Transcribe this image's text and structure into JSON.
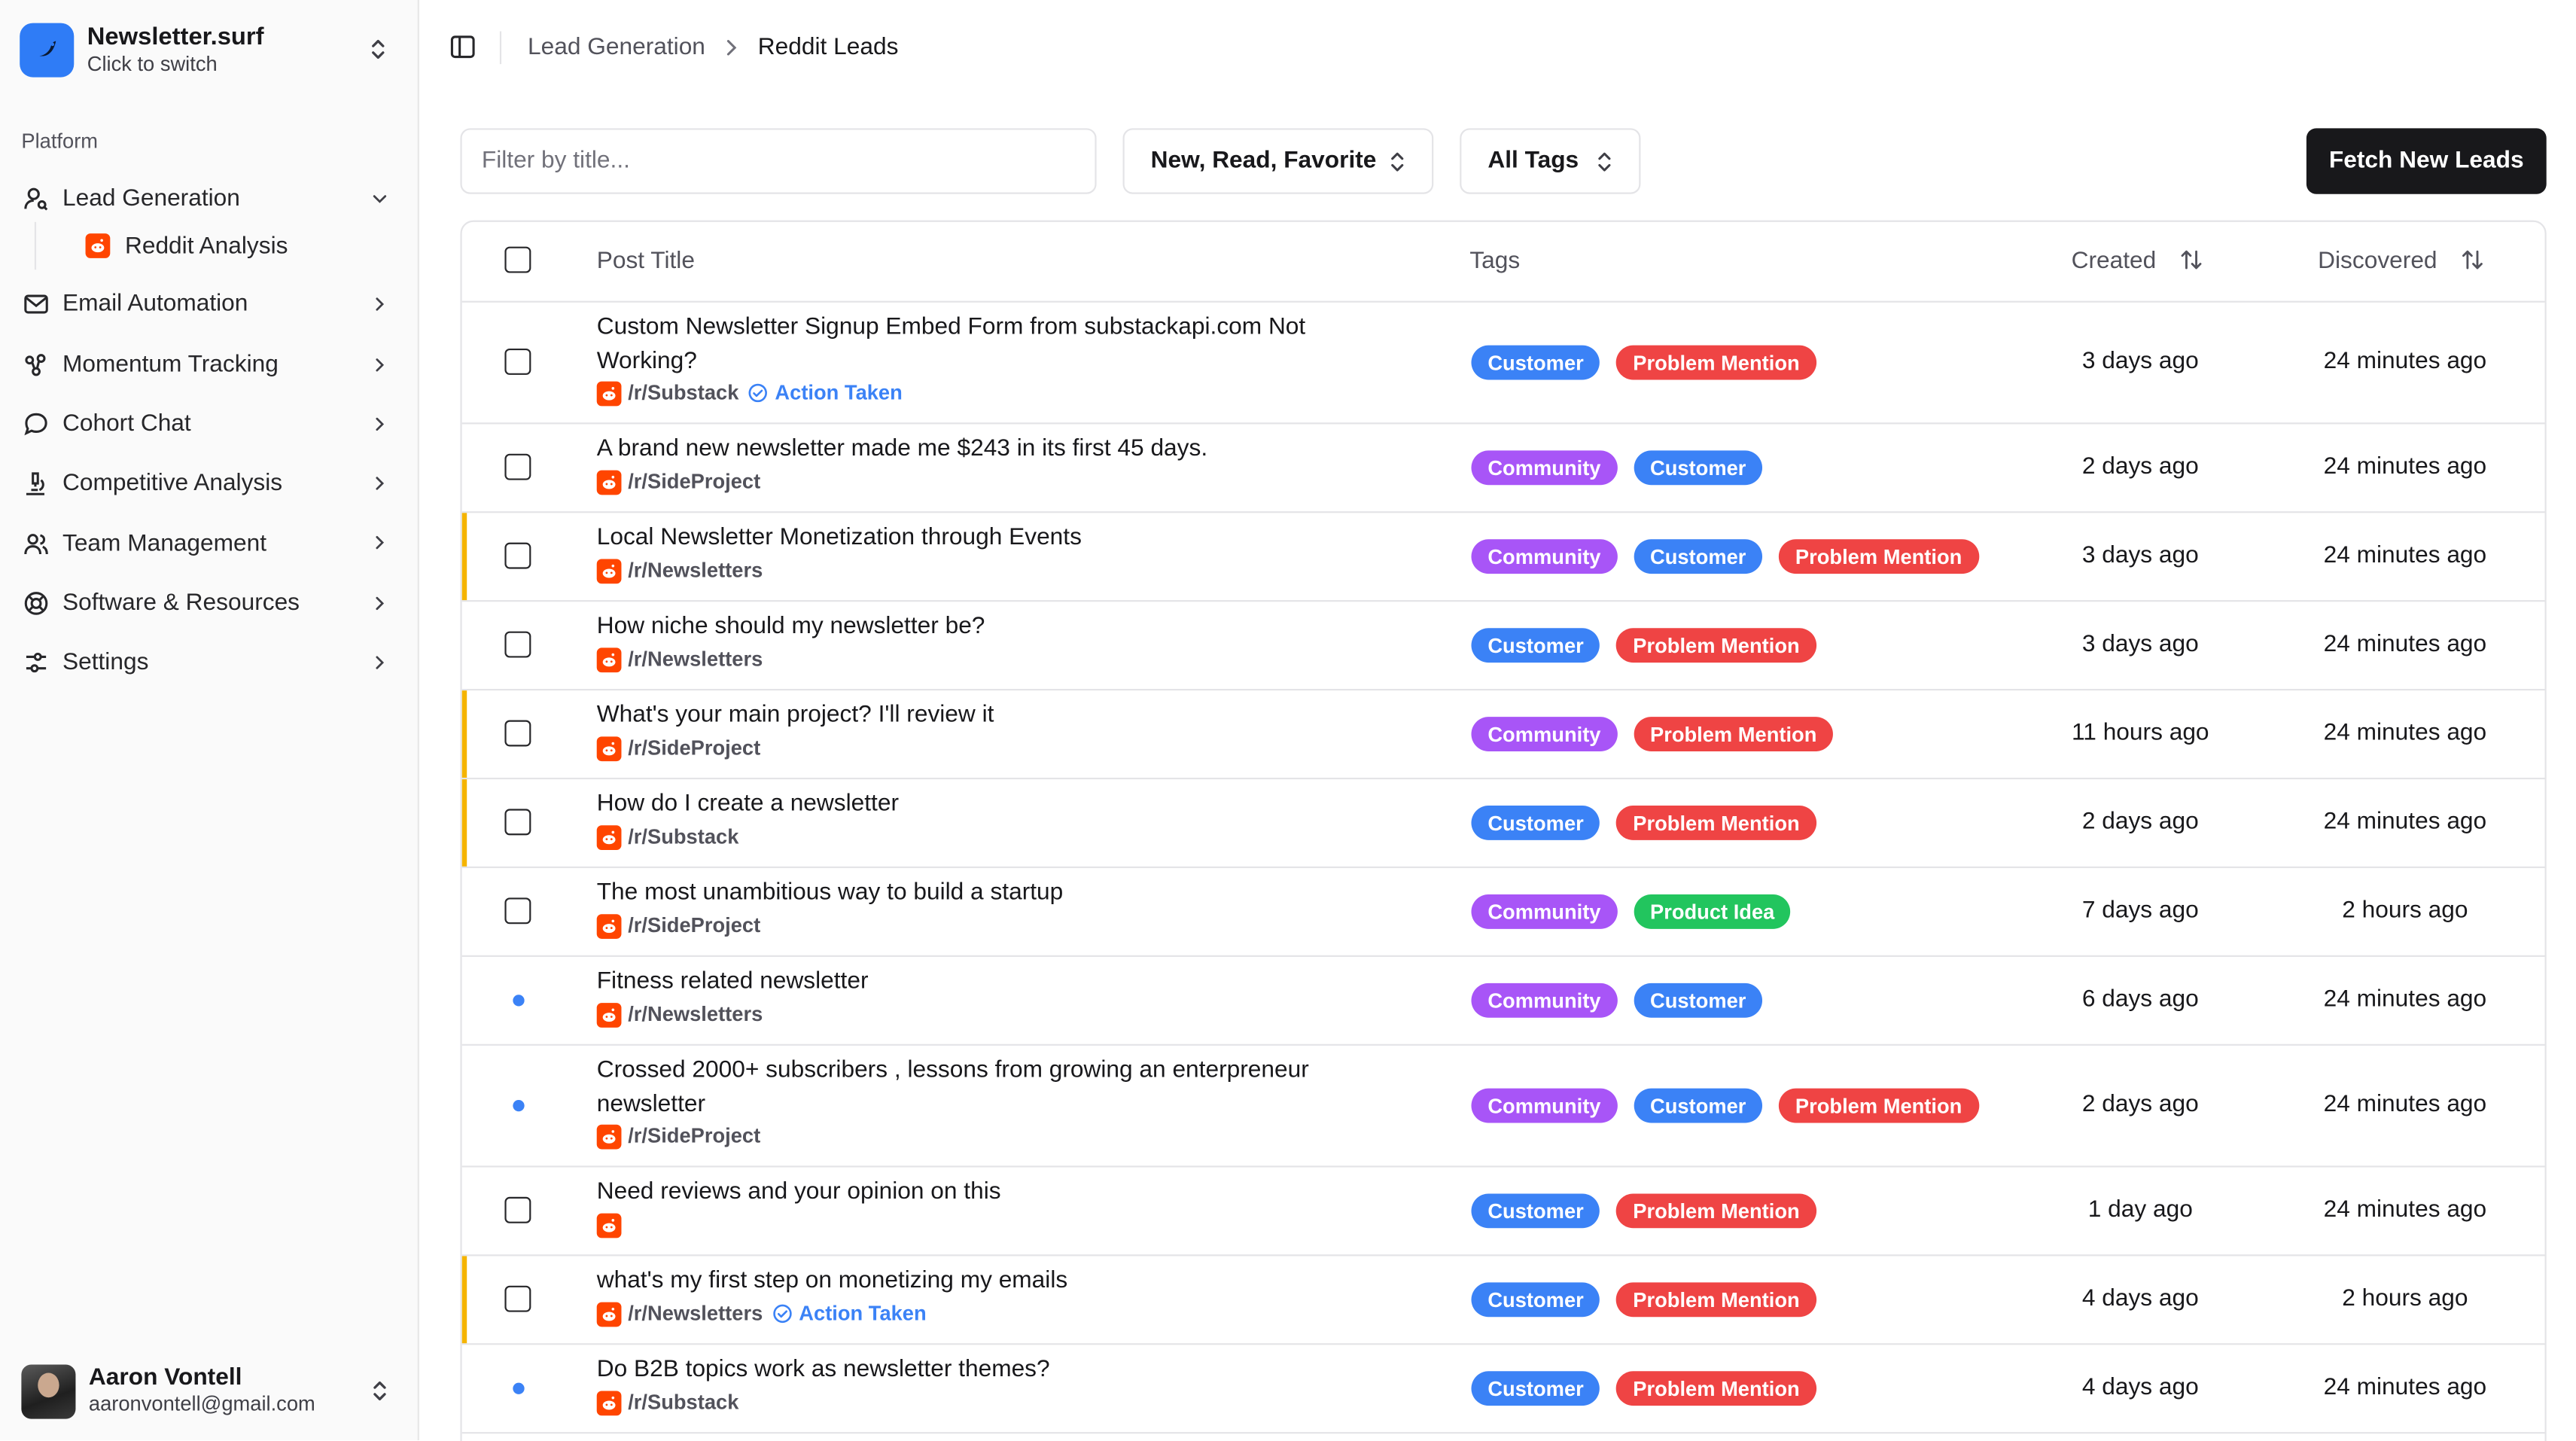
{
  "app": {
    "name": "Newsletter.surf",
    "subtitle": "Click to switch"
  },
  "sidebar": {
    "section_label": "Platform",
    "items": [
      {
        "label": "Lead Generation",
        "icon": "user-search-icon",
        "expanded": true
      },
      {
        "label": "Email Automation",
        "icon": "mail-icon"
      },
      {
        "label": "Momentum Tracking",
        "icon": "chart-icon"
      },
      {
        "label": "Cohort Chat",
        "icon": "chat-bubble-icon"
      },
      {
        "label": "Competitive Analysis",
        "icon": "microscope-icon"
      },
      {
        "label": "Team Management",
        "icon": "users-icon"
      },
      {
        "label": "Software & Resources",
        "icon": "lifebuoy-icon"
      },
      {
        "label": "Settings",
        "icon": "sliders-icon"
      }
    ],
    "subitem": {
      "label": "Reddit Analysis",
      "icon": "reddit-icon"
    }
  },
  "user": {
    "name": "Aaron Vontell",
    "email": "aaronvontell@gmail.com"
  },
  "breadcrumb": {
    "parent": "Lead Generation",
    "current": "Reddit Leads"
  },
  "toolbar": {
    "filter_placeholder": "Filter by title...",
    "status_select": "New, Read, Favorite",
    "tags_select": "All Tags",
    "fetch_button": "Fetch New Leads"
  },
  "table": {
    "columns": {
      "title": "Post Title",
      "tags": "Tags",
      "created": "Created",
      "discovered": "Discovered"
    },
    "rows": [
      {
        "title": "Custom Newsletter Signup Embed Form from substackapi.com Not Working?",
        "subreddit": "/r/Substack",
        "action": "Action Taken",
        "tags": [
          "Customer",
          "Problem Mention"
        ],
        "created": "3 days ago",
        "discovered": "24 minutes ago",
        "state": "checkbox",
        "highlight": false
      },
      {
        "title": "A brand new newsletter made me $243 in its first 45 days.",
        "subreddit": "/r/SideProject",
        "action": "",
        "tags": [
          "Community",
          "Customer"
        ],
        "created": "2 days ago",
        "discovered": "24 minutes ago",
        "state": "checkbox",
        "highlight": false
      },
      {
        "title": "Local Newsletter Monetization through Events",
        "subreddit": "/r/Newsletters",
        "action": "",
        "tags": [
          "Community",
          "Customer",
          "Problem Mention"
        ],
        "created": "3 days ago",
        "discovered": "24 minutes ago",
        "state": "checkbox",
        "highlight": true
      },
      {
        "title": "How niche should my newsletter be?",
        "subreddit": "/r/Newsletters",
        "action": "",
        "tags": [
          "Customer",
          "Problem Mention"
        ],
        "created": "3 days ago",
        "discovered": "24 minutes ago",
        "state": "checkbox",
        "highlight": false
      },
      {
        "title": "What's your main project? I'll review it",
        "subreddit": "/r/SideProject",
        "action": "",
        "tags": [
          "Community",
          "Problem Mention"
        ],
        "created": "11 hours ago",
        "discovered": "24 minutes ago",
        "state": "checkbox",
        "highlight": true
      },
      {
        "title": "How do I create a newsletter",
        "subreddit": "/r/Substack",
        "action": "",
        "tags": [
          "Customer",
          "Problem Mention"
        ],
        "created": "2 days ago",
        "discovered": "24 minutes ago",
        "state": "checkbox",
        "highlight": true
      },
      {
        "title": "The most unambitious way to build a startup",
        "subreddit": "/r/SideProject",
        "action": "",
        "tags": [
          "Community",
          "Product Idea"
        ],
        "created": "7 days ago",
        "discovered": "2 hours ago",
        "state": "checkbox",
        "highlight": false
      },
      {
        "title": "Fitness related newsletter",
        "subreddit": "/r/Newsletters",
        "action": "",
        "tags": [
          "Community",
          "Customer"
        ],
        "created": "6 days ago",
        "discovered": "24 minutes ago",
        "state": "unread",
        "highlight": false
      },
      {
        "title": "Crossed 2000+ subscribers , lessons from growing an enterpreneur newsletter",
        "subreddit": "/r/SideProject",
        "action": "",
        "tags": [
          "Community",
          "Customer",
          "Problem Mention"
        ],
        "created": "2 days ago",
        "discovered": "24 minutes ago",
        "state": "unread",
        "highlight": false
      },
      {
        "title": "Need reviews and your opinion on this",
        "subreddit": "",
        "action": "",
        "tags": [
          "Customer",
          "Problem Mention"
        ],
        "created": "1 day ago",
        "discovered": "24 minutes ago",
        "state": "checkbox",
        "highlight": false
      },
      {
        "title": "what's my first step on monetizing my emails",
        "subreddit": "/r/Newsletters",
        "action": "Action Taken",
        "tags": [
          "Customer",
          "Problem Mention"
        ],
        "created": "4 days ago",
        "discovered": "2 hours ago",
        "state": "checkbox",
        "highlight": true
      },
      {
        "title": "Do B2B topics work as newsletter themes?",
        "subreddit": "/r/Substack",
        "action": "",
        "tags": [
          "Customer",
          "Problem Mention"
        ],
        "created": "4 days ago",
        "discovered": "24 minutes ago",
        "state": "unread",
        "highlight": false
      }
    ]
  },
  "colors": {
    "tag_customer": "#3b82f6",
    "tag_problem": "#ef4444",
    "tag_community": "#a855f7",
    "tag_product": "#22c55e",
    "highlight_bar": "#f5b400",
    "reddit": "#ff4500",
    "primary_button": "#18181b"
  }
}
